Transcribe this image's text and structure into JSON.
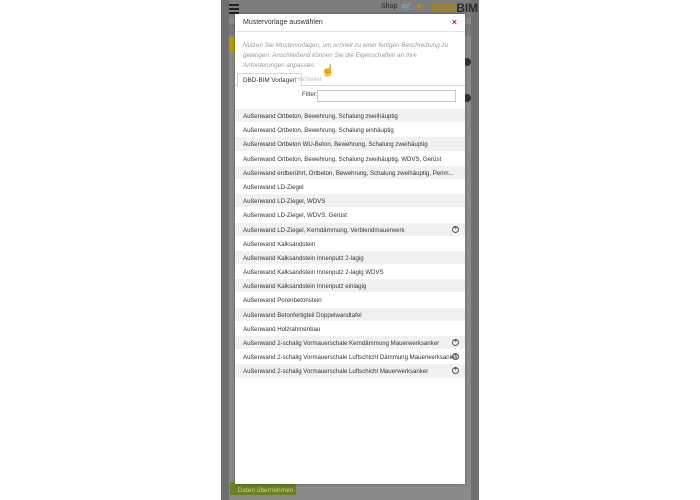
{
  "header": {
    "shop_label": "Shop",
    "logo_part1": "DBD",
    "logo_part2": "BIM"
  },
  "modal": {
    "title": "Mustervorlage auswählen",
    "close_label": "×",
    "intro": "Nutzen Sie Mustervorlagen, um schnell zu einer fertigen Beschreibung zu gelangen. Anschließend können Sie die Eigenschaften an Ihre Anforderungen anpassen.",
    "tabs": [
      {
        "label": "DBD-BIM Vorlagen",
        "active": true
      },
      {
        "label": "Hersteller",
        "active": false
      }
    ],
    "filter": {
      "label": "Filter:",
      "value": "",
      "placeholder": ""
    },
    "items": [
      {
        "label": "Außenwand Ortbeton, Bewehrung, Schalung zweihäuptig",
        "expandable": false
      },
      {
        "label": "Außenwand Ortbeton, Bewehrung, Schalung einhäuptig",
        "expandable": false
      },
      {
        "label": "Außenwand Ortbeton WU-Beton, Bewehrung, Schalung zweihäuptig",
        "expandable": false
      },
      {
        "label": "Außenwand Ortbeton, Bewehrung, Schalung zweihäuptig, WDVS, Gerüst",
        "expandable": false
      },
      {
        "label": "Außenwand erdberührt, Ortbeton, Bewehrung, Schalung zweihäuptig, Perim...",
        "expandable": false
      },
      {
        "label": "Außenwand LD-Ziegel",
        "expandable": false
      },
      {
        "label": "Außenwand LD-Ziegel, WDVS",
        "expandable": false
      },
      {
        "label": "Außenwand LD-Ziegel, WDVS, Gerüst",
        "expandable": false
      },
      {
        "label": "Außenwand LD-Ziegel, Kerndämmung, Verblendmauerwerk",
        "expandable": true
      },
      {
        "label": "Außenwand Kalksandstein",
        "expandable": false
      },
      {
        "label": "Außenwand Kalksandstein Innenputz 2-lagig",
        "expandable": false
      },
      {
        "label": "Außenwand Kalksandstein Innenputz 2-lagig WDVS",
        "expandable": false
      },
      {
        "label": "Außenwand Kalksandstein Innenputz einlagig",
        "expandable": false
      },
      {
        "label": "Außenwand Porenbetonstein",
        "expandable": false
      },
      {
        "label": "Außenwand Betonfertigteil Doppelwandtafel",
        "expandable": false
      },
      {
        "label": "Außenwand Holzrahmenbau",
        "expandable": false
      },
      {
        "label": "Außenwand 2-schalig Vormauerschale Kerndämmung Mauerwerksanker",
        "expandable": true
      },
      {
        "label": "Außenwand 2-schalig Vormauerschale Luftschicht Dämmung Mauerwerksanker",
        "expandable": true
      },
      {
        "label": "Außenwand 2-schalig Vormauerschale Luftschicht Mauerwerksanker",
        "expandable": true
      }
    ]
  },
  "footer": {
    "submit_label": "Daten übernehmen"
  },
  "colors": {
    "accent": "#b08400",
    "close": "#d12020",
    "submit": "#6d7f24"
  }
}
